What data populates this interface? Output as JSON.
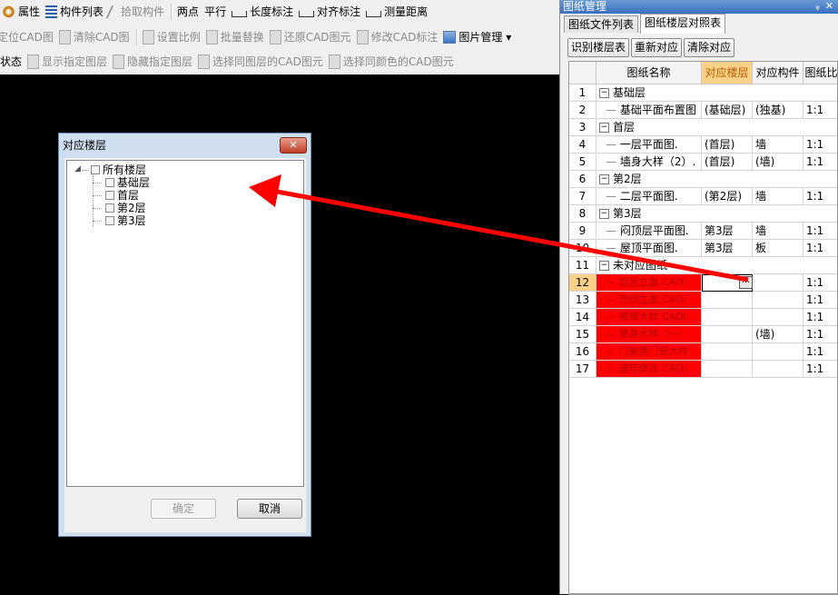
{
  "toolbar": {
    "row1": [
      {
        "label": "属性",
        "icon": "gear-icon",
        "disabled": false
      },
      {
        "label": "构件列表",
        "icon": "list-icon",
        "disabled": false
      },
      {
        "label": "拾取构件",
        "icon": "pick-icon",
        "disabled": true
      },
      {
        "label": "两点",
        "icon": "two-point-icon",
        "disabled": false
      },
      {
        "label": "平行",
        "icon": "parallel-icon",
        "disabled": false
      },
      {
        "label": "长度标注",
        "icon": "length-dim-icon",
        "disabled": false
      },
      {
        "label": "对齐标注",
        "icon": "align-dim-icon",
        "disabled": false
      },
      {
        "label": "测量距离",
        "icon": "measure-icon",
        "disabled": false
      }
    ],
    "row2": [
      {
        "label": "定位CAD图",
        "icon": "",
        "disabled": true
      },
      {
        "label": "清除CAD图",
        "icon": "clear-cad-icon",
        "disabled": true
      },
      {
        "label": "设置比例",
        "icon": "scale-icon",
        "disabled": true
      },
      {
        "label": "批量替换",
        "icon": "replace-icon",
        "disabled": true
      },
      {
        "label": "还原CAD图元",
        "icon": "restore-icon",
        "disabled": true
      },
      {
        "label": "修改CAD标注",
        "icon": "edit-dim-icon",
        "disabled": true
      },
      {
        "label": "图片管理 ▾",
        "icon": "image-manage-icon",
        "disabled": false
      }
    ],
    "row3": [
      {
        "label": "状态",
        "icon": "",
        "disabled": false
      },
      {
        "label": "显示指定图层",
        "icon": "show-layer-icon",
        "disabled": true
      },
      {
        "label": "隐藏指定图层",
        "icon": "hide-layer-icon",
        "disabled": true
      },
      {
        "label": "选择同图层的CAD图元",
        "icon": "select-layer-icon",
        "disabled": true
      },
      {
        "label": "选择同颜色的CAD图元",
        "icon": "select-color-icon",
        "disabled": true
      }
    ]
  },
  "dialog": {
    "title": "对应楼层",
    "close_label": "✕",
    "tree_root": "所有楼层",
    "tree_items": [
      "基础层",
      "首层",
      "第2层",
      "第3层"
    ],
    "ok_label": "确定",
    "cancel_label": "取消"
  },
  "panel": {
    "title": "图纸管理",
    "pin": "ᵩ",
    "close": "✕",
    "tabs": [
      "图纸文件列表",
      "图纸楼层对照表"
    ],
    "active_tab": 1,
    "buttons": [
      "识别楼层表",
      "重新对应",
      "清除对应"
    ],
    "columns": [
      "",
      "图纸名称",
      "对应楼层",
      "对应构件",
      "图纸比"
    ],
    "rows": [
      {
        "num": "1",
        "type": "group",
        "name": "基础层",
        "floor": "",
        "comp": "",
        "ratio": ""
      },
      {
        "num": "2",
        "type": "item",
        "name": "基础平面布置图",
        "floor": "(基础层)",
        "comp": "(独基)",
        "ratio": "1:1"
      },
      {
        "num": "3",
        "type": "group",
        "name": "首层",
        "floor": "",
        "comp": "",
        "ratio": ""
      },
      {
        "num": "4",
        "type": "item",
        "name": "一层平面图.",
        "floor": "(首层)",
        "comp": "墙",
        "ratio": "1:1"
      },
      {
        "num": "5",
        "type": "item",
        "name": "墙身大样（2）.",
        "floor": "(首层)",
        "comp": "(墙)",
        "ratio": "1:1"
      },
      {
        "num": "6",
        "type": "group",
        "name": "第2层",
        "floor": "",
        "comp": "",
        "ratio": ""
      },
      {
        "num": "7",
        "type": "item",
        "name": "二层平面图.",
        "floor": "(第2层)",
        "comp": "墙",
        "ratio": "1:1"
      },
      {
        "num": "8",
        "type": "group",
        "name": "第3层",
        "floor": "",
        "comp": "",
        "ratio": ""
      },
      {
        "num": "9",
        "type": "item",
        "name": "闷顶层平面图.",
        "floor": "第3层",
        "comp": "墙",
        "ratio": "1:1"
      },
      {
        "num": "10",
        "type": "item",
        "name": "屋顶平面图.",
        "floor": "第3层",
        "comp": "板",
        "ratio": "1:1"
      },
      {
        "num": "11",
        "type": "group",
        "name": "未对应图纸",
        "floor": "",
        "comp": "",
        "ratio": ""
      },
      {
        "num": "12",
        "type": "red",
        "name": "前后立面.CADI",
        "floor": "",
        "comp": "",
        "ratio": "1:1",
        "selected": true
      },
      {
        "num": "13",
        "type": "red",
        "name": "西侧立面.CADI",
        "floor": "",
        "comp": "",
        "ratio": "1:1"
      },
      {
        "num": "14",
        "type": "red",
        "name": "楼梯大样.CADI",
        "floor": "",
        "comp": "",
        "ratio": "1:1"
      },
      {
        "num": "15",
        "type": "red",
        "name": "墙身大样（一）",
        "floor": "",
        "comp": "(墙)",
        "ratio": "1:1"
      },
      {
        "num": "16",
        "type": "red",
        "name": "门窗表门窗大样.",
        "floor": "",
        "comp": "",
        "ratio": "1:1"
      },
      {
        "num": "17",
        "type": "red",
        "name": "建筑做法.CADI",
        "floor": "",
        "comp": "",
        "ratio": "1:1"
      }
    ],
    "ellipsis": "…"
  },
  "colors": {
    "arrow": "#ff0000",
    "unmatched_row": "#ff0000",
    "active_header": "#fbd18a"
  }
}
